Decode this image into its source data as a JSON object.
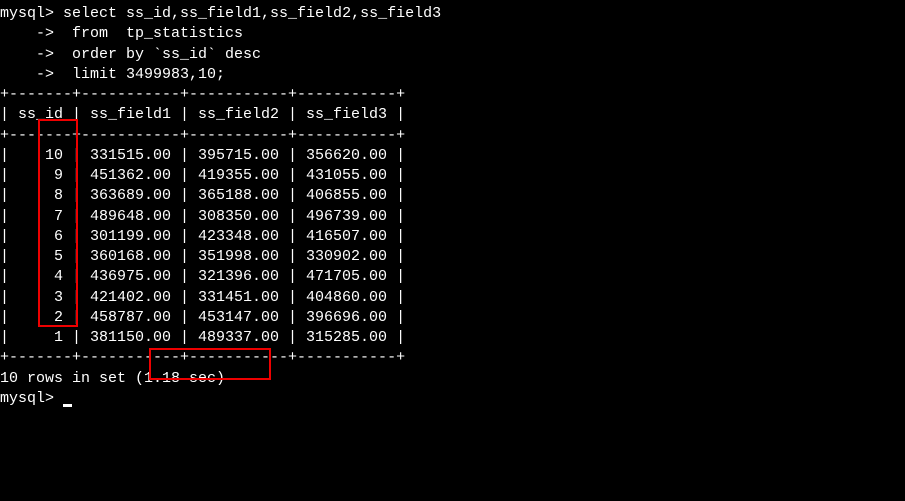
{
  "prompt": "mysql>",
  "arrow": "    ->",
  "query": {
    "line1": " select ss_id,ss_field1,ss_field2,ss_field3",
    "line2": "  from  tp_statistics",
    "line3": "  order by `ss_id` desc",
    "line4": "  limit 3499983,10;"
  },
  "border": {
    "top": "+-------+-----------+-----------+-----------+",
    "header": "| ss_id | ss_field1 | ss_field2 | ss_field3 |",
    "mid": "+-------+-----------+-----------+-----------+",
    "bottom": "+-------+-----------+-----------+-----------+"
  },
  "rows": [
    "|    10 | 331515.00 | 395715.00 | 356620.00 |",
    "|     9 | 451362.00 | 419355.00 | 431055.00 |",
    "|     8 | 363689.00 | 365188.00 | 406855.00 |",
    "|     7 | 489648.00 | 308350.00 | 496739.00 |",
    "|     6 | 301199.00 | 423348.00 | 416507.00 |",
    "|     5 | 360168.00 | 351998.00 | 330902.00 |",
    "|     4 | 436975.00 | 321396.00 | 471705.00 |",
    "|     3 | 421402.00 | 331451.00 | 404860.00 |",
    "|     2 | 458787.00 | 453147.00 | 396696.00 |",
    "|     1 | 381150.00 | 489337.00 | 315285.00 |"
  ],
  "summary": "10 rows in set (1.18 sec)",
  "blank": "",
  "prompt2": "mysql> "
}
